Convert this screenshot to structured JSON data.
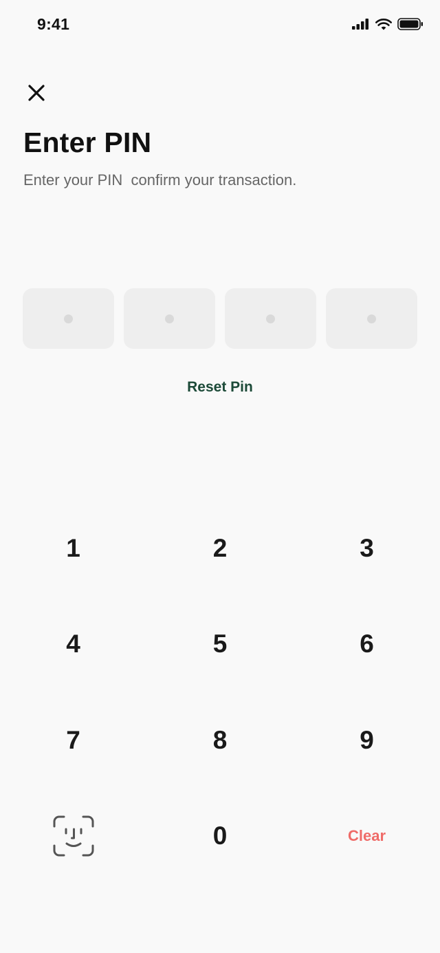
{
  "status_bar": {
    "time": "9:41"
  },
  "header": {
    "close_icon": "close-icon",
    "title": "Enter PIN",
    "subtitle": "Enter your PIN  confirm your transaction."
  },
  "pin": {
    "slots": 4,
    "filled": 0,
    "reset_label": "Reset Pin",
    "box_color": "#eeeeee",
    "dot_color": "#d9d9d9"
  },
  "keypad": {
    "keys": [
      "1",
      "2",
      "3",
      "4",
      "5",
      "6",
      "7",
      "8",
      "9"
    ],
    "zero": "0",
    "biometric_icon": "face-id-icon",
    "clear_label": "Clear"
  },
  "colors": {
    "background": "#f9f9f9",
    "accent_green": "#1c4a38",
    "clear_red": "#ef6b68",
    "text": "#111111",
    "subtitle": "#666666"
  }
}
